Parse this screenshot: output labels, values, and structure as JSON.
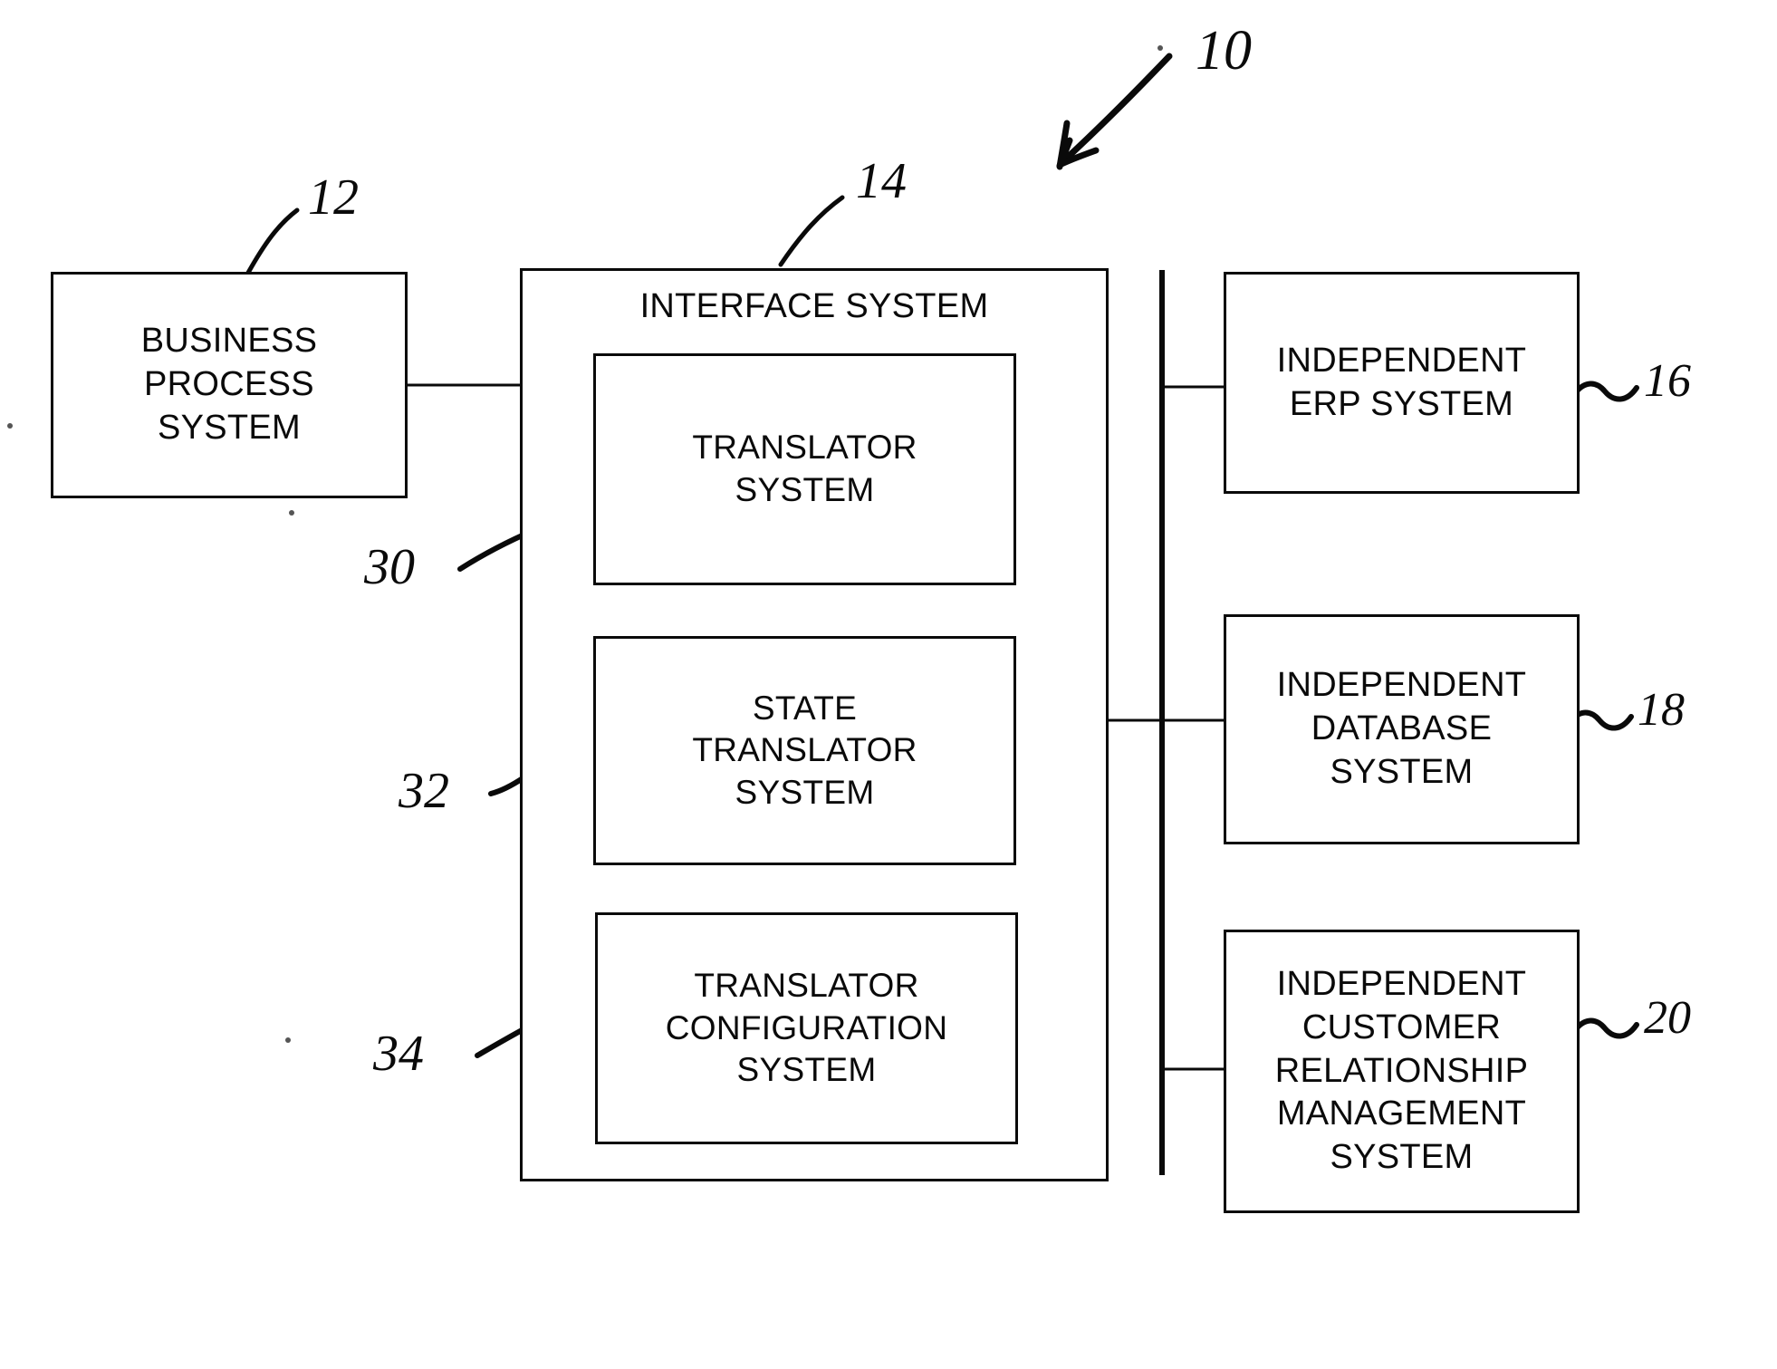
{
  "figure": {
    "type": "patent-block-diagram",
    "main_reference": "10"
  },
  "boxes": {
    "business_process_system": {
      "label": "BUSINESS\nPROCESS\nSYSTEM",
      "ref": "12"
    },
    "interface_system": {
      "title": "INTERFACE SYSTEM",
      "ref": "14"
    },
    "translator_system": {
      "label": "TRANSLATOR\nSYSTEM",
      "ref": "30"
    },
    "state_translator_system": {
      "label": "STATE\nTRANSLATOR\nSYSTEM",
      "ref": "32"
    },
    "translator_configuration_system": {
      "label": "TRANSLATOR\nCONFIGURATION\nSYSTEM",
      "ref": "34"
    },
    "independent_erp_system": {
      "label": "INDEPENDENT\nERP SYSTEM",
      "ref": "16"
    },
    "independent_database_system": {
      "label": "INDEPENDENT\nDATABASE\nSYSTEM",
      "ref": "18"
    },
    "independent_crm_system": {
      "label": "INDEPENDENT\nCUSTOMER\nRELATIONSHIP\nMANAGEMENT\nSYSTEM",
      "ref": "20"
    }
  },
  "colors": {
    "ink": "#0a0a0a",
    "background": "#ffffff"
  }
}
